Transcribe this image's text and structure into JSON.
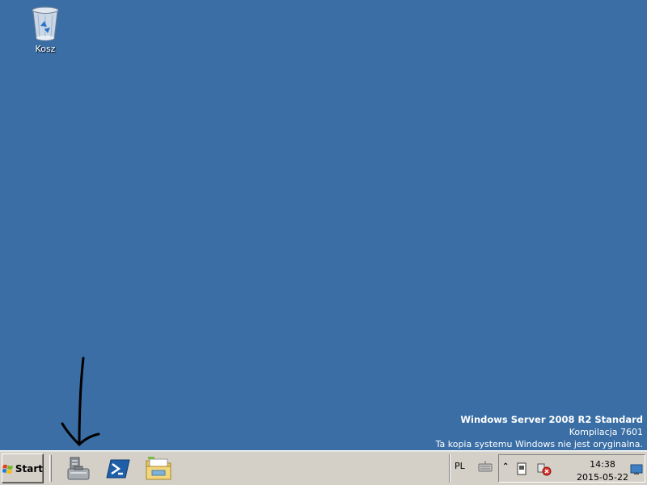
{
  "desktop": {
    "icons": [
      {
        "label": "Kosz",
        "icon": "recycle-bin-icon"
      }
    ],
    "background_color": "#3a6ea5"
  },
  "watermark": {
    "title": "Windows Server 2008 R2 Standard",
    "build": "Kompilacja 7601",
    "notice": "Ta kopia systemu Windows nie jest oryginalna."
  },
  "taskbar": {
    "start_label": "Start",
    "pinned": [
      {
        "name": "server-manager",
        "icon": "server-manager-icon"
      },
      {
        "name": "powershell",
        "icon": "powershell-icon"
      },
      {
        "name": "windows-explorer",
        "icon": "folder-icon"
      }
    ],
    "language": "PL",
    "tray": {
      "time": "14:38",
      "date": "2015-05-22"
    },
    "colors": {
      "taskbar": "#d4d0c8",
      "powershell": "#1f5fa8"
    }
  }
}
